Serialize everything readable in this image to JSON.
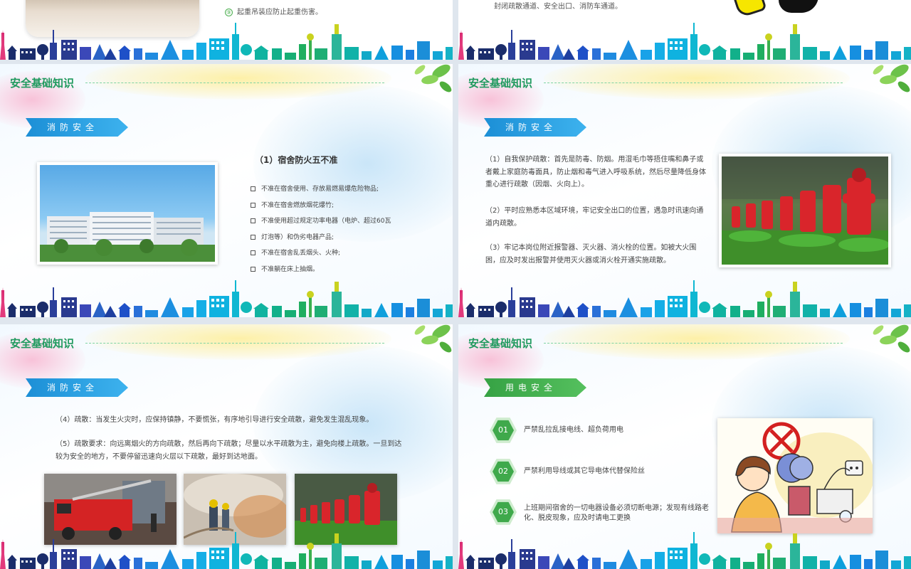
{
  "top_strip": {
    "left_item_number": "⑨",
    "left_item_text": "起重吊装应防止起重伤害。",
    "right_text": "封闭疏散通道、安全出口、消防车通道。"
  },
  "slides": [
    {
      "title": "安全基础知识",
      "ribbon": "消防安全",
      "rule_title": "（1）宿舍防火五不准",
      "rules": [
        "不准在宿舍使用、存放易燃易爆危险物品;",
        "不准在宿舍燃放烟花爆竹;",
        "不准使用超过规定功率电器（电炉、超过60瓦",
        "灯泡等）和伪劣电器产品;",
        "不准在宿舍乱丢烟头、火种;",
        "不准躺在床上抽烟。"
      ]
    },
    {
      "title": "安全基础知识",
      "ribbon": "消防安全",
      "paragraphs": [
        "（1）自我保护疏散：首先是防毒、防烟。用湿毛巾等捂住嘴和鼻子或者戴上家庭防毒面具，防止烟和毒气进入呼吸系统，然后尽量降低身体重心进行疏散（因烟、火向上）。",
        "（2）平时应熟悉本区域环境，牢记安全出口的位置，遇急时讯速向通道内疏散。",
        "（3）牢记本岗位附近报警器、灭火器、消火栓的位置。如被大火围困，应及时发出报警并使用灭火器或消火栓开通实施疏散。"
      ]
    },
    {
      "title": "安全基础知识",
      "ribbon": "消防安全",
      "paragraphs": [
        "（4）疏散：当发生火灾时，应保持镇静，不要慌张，有序地引导进行安全疏散，避免发生混乱现象。",
        "（5）疏散要求：向远离烟火的方向疏散，然后再向下疏散；尽量以水平疏散为主，避免向楼上疏散。一旦到达较为安全的地方，不要停留迅速向火层以下疏散，最好到达地面。"
      ]
    },
    {
      "title": "安全基础知识",
      "ribbon": "用电安全",
      "items": [
        {
          "num": "01",
          "text": "严禁乱拉乱接电线、超负荷用电"
        },
        {
          "num": "02",
          "text": "严禁利用导线或其它导电体代替保险丝"
        },
        {
          "num": "03",
          "text": "上班期间宿舍的一切电器设备必须切断电源；发现有线路老化、脱皮现象，应及时请电工更换"
        }
      ]
    }
  ],
  "colors": {
    "title_green": "#1f9a5e",
    "ribbon_blue": "#1c8fd6",
    "ribbon_green": "#36a244",
    "hydrant_red": "#e0262b",
    "prohibition_red": "#d32020"
  },
  "icons": [
    "checkbox-icon",
    "leaves-icon",
    "prohibition-icon",
    "city-skyline-icon"
  ]
}
